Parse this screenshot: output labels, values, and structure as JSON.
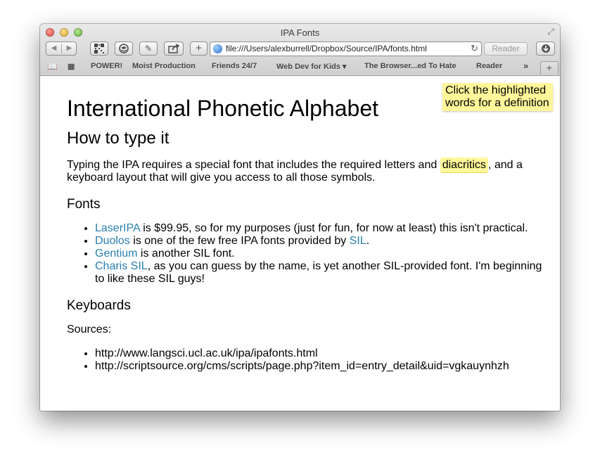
{
  "window": {
    "title": "IPA Fonts"
  },
  "toolbar": {
    "back_icon": "back-arrow-icon",
    "forward_icon": "forward-arrow-icon",
    "url": "file:///Users/alexburrell/Dropbox/Source/IPA/fonts.html",
    "reader_label": "Reader"
  },
  "bookmarks": {
    "items": [
      {
        "label": "POWER!"
      },
      {
        "label": "Moist Production"
      },
      {
        "label": "Friends 24/7"
      },
      {
        "label": "Web Dev for Kids ▾"
      },
      {
        "label": "The Browser...ed To Hate"
      },
      {
        "label": "Reader"
      }
    ],
    "more": "»"
  },
  "page": {
    "tooltip": "Click the highlighted words for a definition",
    "title": "International Phonetic Alphabet",
    "subtitle": "How to type it",
    "intro_before": "Typing the IPA requires a special font that includes the required letters and ",
    "intro_highlight": "diacritics",
    "intro_after": ", and a keyboard layout that will give you access to all those symbols.",
    "fonts_heading": "Fonts",
    "fonts": [
      {
        "link": "LaserIPA",
        "text": " is $99.95, so for my purposes (just for fun, for now at least) this isn't practical."
      },
      {
        "link": "Duolos",
        "text": " is one of the few free IPA fonts provided by ",
        "link2": "SIL",
        "text2": "."
      },
      {
        "link": "Gentium",
        "text": " is another SIL font."
      },
      {
        "link": "Charis SIL",
        "text": ", as you can guess by the name, is yet another SIL-provided font. I'm beginning to like these SIL guys!"
      }
    ],
    "keyboards_heading": "Keyboards",
    "sources_label": "Sources:",
    "sources": [
      "http://www.langsci.ucl.ac.uk/ipa/ipafonts.html",
      "http://scriptsource.org/cms/scripts/page.php?item_id=entry_detail&uid=vgkauynhzh"
    ]
  }
}
